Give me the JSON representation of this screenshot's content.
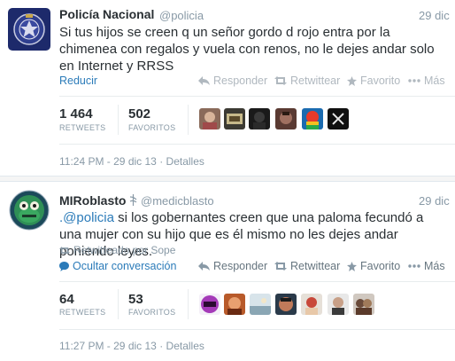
{
  "tweet1": {
    "name": "Policía Nacional",
    "handle": "@policia",
    "date": "29 dic",
    "text": "Si tus hijos se creen q un señor gordo d rojo entra por la chimenea con regalos y vuela con renos, no le dejes andar solo en Internet y RRSS",
    "collapse_label": "Reducir",
    "actions": {
      "reply": "Responder",
      "retweet": "Retwittear",
      "favorite": "Favorito",
      "more": "Más"
    },
    "retweets_count": "1 464",
    "retweets_label": "RETWEETS",
    "favorites_count": "502",
    "favorites_label": "FAVORITOS",
    "timestamp": "11:24 PM - 29 dic 13",
    "details_label": "Detalles"
  },
  "tweet2": {
    "name": "MIRoblasto",
    "handle": "@medicblasto",
    "date": "29 dic",
    "mention": ".@policia",
    "text": " si los gobernantes creen que una paloma fecundó a una mujer con su hijo que es él mismo no les dejes andar poniendo leyes.",
    "retweeted_by": "Retwitteado por Sope",
    "hide_conversation": "Ocultar conversación",
    "actions": {
      "reply": "Responder",
      "retweet": "Retwittear",
      "favorite": "Favorito",
      "more": "Más"
    },
    "retweets_count": "64",
    "retweets_label": "RETWEETS",
    "favorites_count": "53",
    "favorites_label": "FAVORITOS",
    "timestamp": "11:27 PM - 29 dic 13",
    "details_label": "Detalles"
  },
  "colors": {
    "link": "#2b7bb9",
    "muted": "#8899a6",
    "text": "#292f33",
    "action": "#b0b8bf"
  },
  "icons": [
    "police-badge-avatar",
    "robot-avatar",
    "reply-icon",
    "retweet-icon",
    "star-icon",
    "more-dots-icon",
    "verified-icon",
    "retweet-small-icon",
    "conversation-icon"
  ]
}
